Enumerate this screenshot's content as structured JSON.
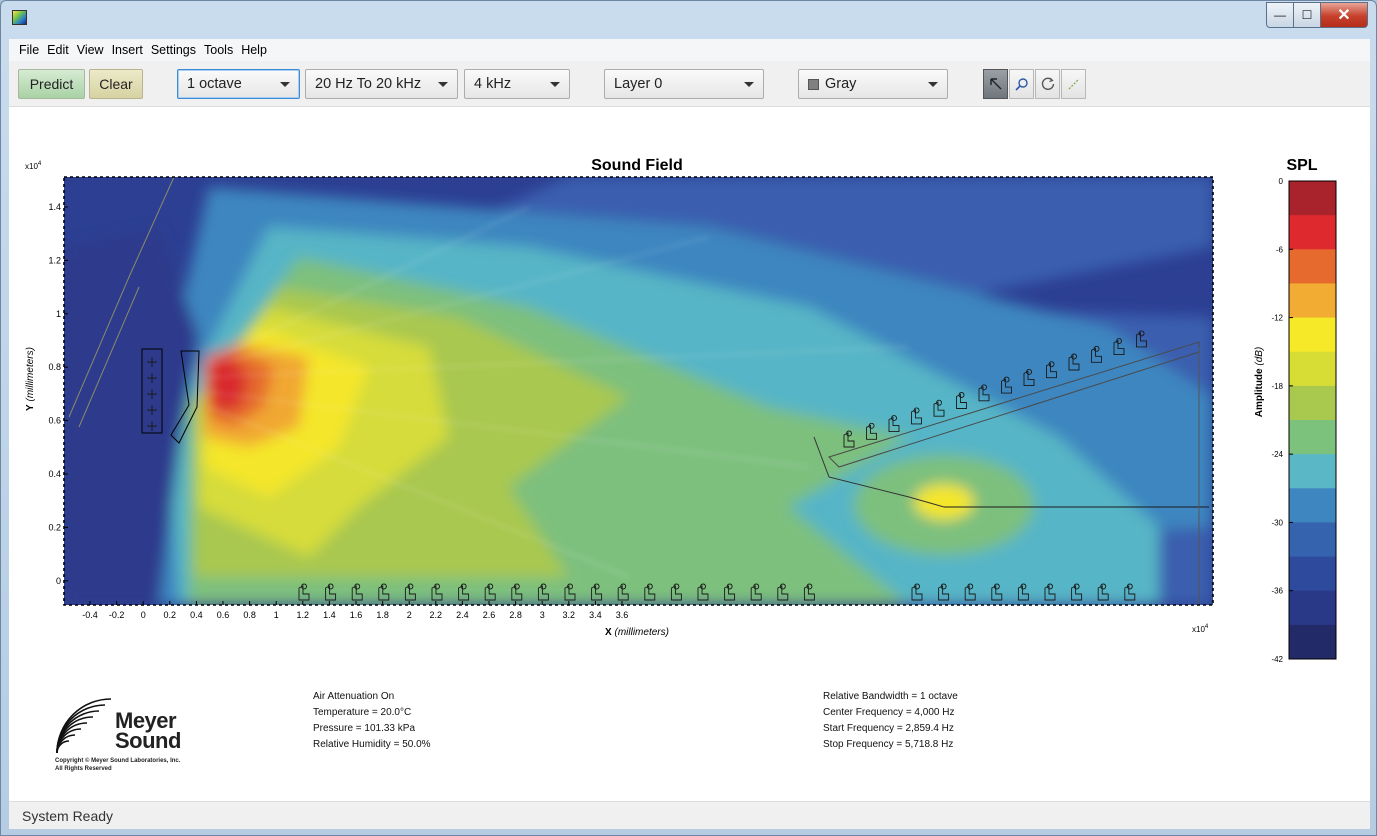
{
  "window": {
    "min": "—",
    "max": "☐",
    "close": "✕"
  },
  "menu": [
    "File",
    "Edit",
    "View",
    "Insert",
    "Settings",
    "Tools",
    "Help"
  ],
  "toolbar": {
    "predict": "Predict",
    "clear": "Clear",
    "bandwidth": "1 octave",
    "range": "20 Hz To 20 kHz",
    "frequency": "4 kHz",
    "layer": "Layer 0",
    "color_mode": "Gray"
  },
  "plot": {
    "title": "Sound Field",
    "xlabel": "X",
    "xunit": "(millimeters)",
    "ylabel": "Y",
    "yunit": "(millimeters)",
    "x_exponent": "x10",
    "y_exponent": "x10",
    "exponent_power": "4",
    "x_ticks": [
      "-0.4",
      "-0.2",
      "0",
      "0.2",
      "0.4",
      "0.6",
      "0.8",
      "1",
      "1.2",
      "1.4",
      "1.6",
      "1.8",
      "2",
      "2.2",
      "2.4",
      "2.6",
      "2.8",
      "3",
      "3.2",
      "3.4",
      "3.6"
    ],
    "y_ticks": [
      "1.4",
      "1.2",
      "1",
      "0.8",
      "0.6",
      "0.4",
      "0.2",
      "0"
    ]
  },
  "colorbar": {
    "title": "SPL",
    "label": "Amplitude",
    "unit": "(dB)",
    "ticks": [
      "0",
      "-6",
      "-12",
      "-18",
      "-24",
      "-30",
      "-36",
      "-42"
    ],
    "colors": [
      "#a8232b",
      "#de2a2e",
      "#e66a2e",
      "#f2ac33",
      "#f5e928",
      "#d8dd36",
      "#a8c94e",
      "#7dc27c",
      "#5ab8c6",
      "#3e86c0",
      "#3563ad",
      "#2e4a9c",
      "#2a3888",
      "#232a68"
    ]
  },
  "info_left": [
    "Air Attenuation On",
    "Temperature = 20.0°C",
    "Pressure = 101.33  kPa",
    "Relative Humidity = 50.0%"
  ],
  "info_right": [
    "Relative Bandwidth = 1 octave",
    "Center Frequency = 4,000 Hz",
    "Start Frequency = 2,859.4 Hz",
    "Stop Frequency = 5,718.8 Hz"
  ],
  "logo": {
    "line1": "Meyer",
    "line2": "Sound",
    "copyright1": "Copyright © Meyer Sound Laboratories, Inc.",
    "copyright2": "All Rights Reserved"
  },
  "status": "System Ready"
}
